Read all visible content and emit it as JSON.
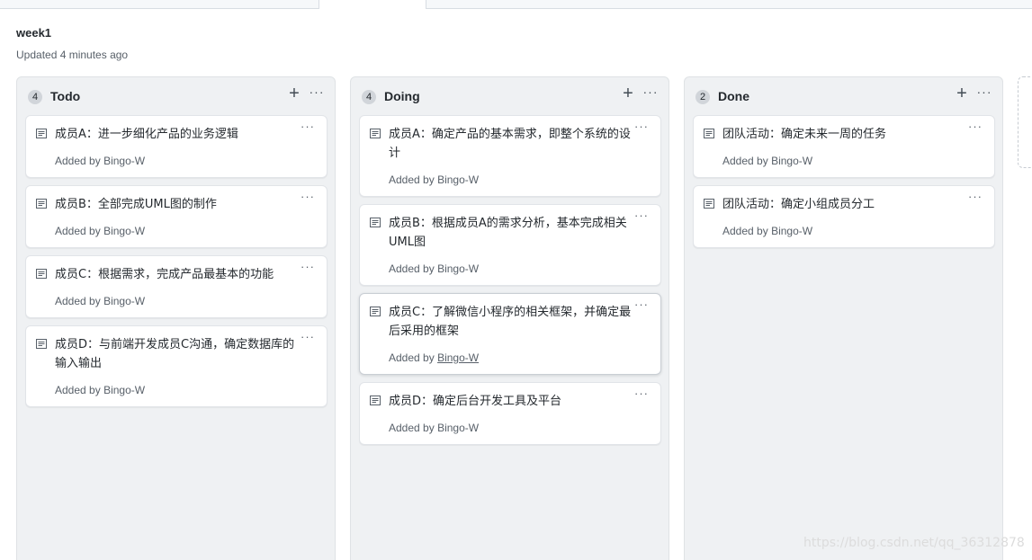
{
  "project": {
    "title": "week1",
    "updated": "Updated 4 minutes ago"
  },
  "columns": [
    {
      "count": "4",
      "name": "Todo",
      "add_icon": "plus-icon",
      "more_icon": "kebab-horizontal-icon",
      "cards": [
        {
          "text": "成员A：进一步细化产品的业务逻辑",
          "added_prefix": "Added by",
          "author": "Bingo-W"
        },
        {
          "text": "成员B：全部完成UML图的制作",
          "added_prefix": "Added by",
          "author": "Bingo-W"
        },
        {
          "text": "成员C：根据需求，完成产品最基本的功能",
          "added_prefix": "Added by",
          "author": "Bingo-W"
        },
        {
          "text": "成员D：与前端开发成员C沟通，确定数据库的输入输出",
          "added_prefix": "Added by",
          "author": "Bingo-W"
        }
      ]
    },
    {
      "count": "4",
      "name": "Doing",
      "add_icon": "plus-icon",
      "more_icon": "kebab-horizontal-icon",
      "cards": [
        {
          "text": "成员A：确定产品的基本需求，即整个系统的设计",
          "added_prefix": "Added by",
          "author": "Bingo-W"
        },
        {
          "text": "成员B：根据成员A的需求分析，基本完成相关UML图",
          "added_prefix": "Added by",
          "author": "Bingo-W"
        },
        {
          "text": "成员C：了解微信小程序的相关框架，并确定最后采用的框架",
          "added_prefix": "Added by",
          "author": "Bingo-W"
        },
        {
          "text": "成员D：确定后台开发工具及平台",
          "added_prefix": "Added by",
          "author": "Bingo-W"
        }
      ]
    },
    {
      "count": "2",
      "name": "Done",
      "add_icon": "plus-icon",
      "more_icon": "kebab-horizontal-icon",
      "cards": [
        {
          "text": "团队活动：确定未来一周的任务",
          "added_prefix": "Added by",
          "author": "Bingo-W"
        },
        {
          "text": "团队活动：确定小组成员分工",
          "added_prefix": "Added by",
          "author": "Bingo-W"
        }
      ]
    }
  ],
  "card_icon": "note-icon",
  "card_more_label": "···",
  "column_add_label": "+",
  "column_more_label": "···",
  "watermark": "https://blog.csdn.net/qq_36312878",
  "colors": {
    "column_bg": "#eff1f3",
    "card_bg": "#ffffff",
    "text": "#24292e",
    "muted": "#586069"
  }
}
